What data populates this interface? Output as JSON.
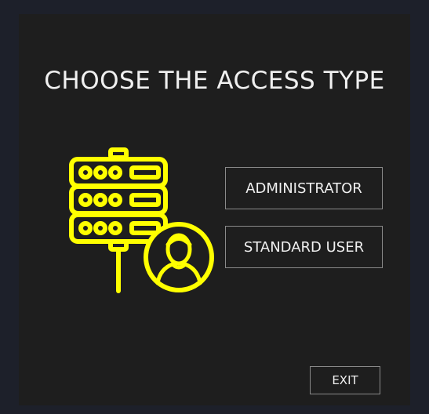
{
  "screen": {
    "title": "CHOOSE THE ACCESS TYPE"
  },
  "illustration": {
    "icon": "server-user-icon",
    "color": "#ffff00"
  },
  "actions": {
    "administrator_label": "ADMINISTRATOR",
    "standard_user_label": "STANDARD USER",
    "exit_label": "EXIT"
  },
  "colors": {
    "background": "#1d202a",
    "panel": "#1e1e1e",
    "text": "#f0f0f0",
    "button_border": "#8a8a8a",
    "accent": "#ffff00"
  }
}
